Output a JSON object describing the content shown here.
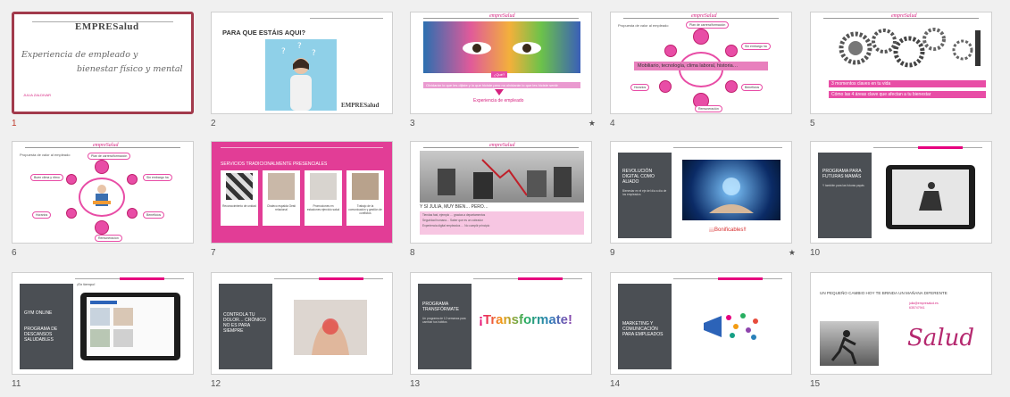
{
  "slides": [
    {
      "num": "1",
      "selected": true,
      "logo": "EMPRESalud",
      "title_line1": "Experiencia de empleado y",
      "title_line2": "bienestar físico y mental",
      "author": "JULIA ZALDIVAR"
    },
    {
      "num": "2",
      "title": "PARA QUE ESTÁIS AQUI?",
      "logo": "EMPRESalud"
    },
    {
      "num": "3",
      "starred": true,
      "logo": "empreSalud",
      "bar_text": "Olvidarán lo que les dijiste y lo que hiciste pero no olvidarán lo que les hiciste sentir",
      "small_tag": "¿Qué?",
      "caption": "Experiencia de empleado"
    },
    {
      "num": "4",
      "logo": "empreSalud",
      "heading": "Propuesta de valor al empleado",
      "bar_text": "Mobiliario, tecnología, clima laboral, historia…",
      "labels": [
        "Plan de carrera/formación",
        "Sin embargo ha",
        "Horarios",
        "Remuneración",
        "Beneficios"
      ]
    },
    {
      "num": "5",
      "logo": "empreSalud",
      "bar1": "3 momentos claves en tu vida",
      "bar2": "Cómo las 4 áreas clave que afectan a tu bienestar"
    },
    {
      "num": "6",
      "logo": "empreSalud",
      "heading": "Propuesta de valor al empleado",
      "labels": [
        "Plan de carrera/formación",
        "Buen clima y ritmo",
        "Sin embargo ha",
        "Horarios",
        "Remuneración",
        "Beneficios"
      ]
    },
    {
      "num": "7",
      "title": "SERVICIOS TRADICIONALMENTE PRESENCIALES",
      "cards": [
        "Reconocimiento de unidad",
        "Chaleco espalda Gesti relacional",
        "Promociones en estaciones ejercicio salud",
        "Trabajo de la comunicación y gestión de conflictos"
      ]
    },
    {
      "num": "8",
      "logo": "empreSalud",
      "heading": "Y SÍ JULIA, MUY BIEN… PERO…",
      "rows": [
        "Tiendas fast, ejemplo … gracias a departamentos",
        "Seguridad humana… Saber que es un cobrador",
        "Experiencia digital empleados … No cumplir principio"
      ]
    },
    {
      "num": "9",
      "starred": true,
      "panel_title": "REVOLUCIÓN DIGITAL COMO ALIADO",
      "panel_body": "Bienestar en el eje del día a día de los empleados",
      "caption": "¡¡¡Bonificables!!"
    },
    {
      "num": "10",
      "panel_title": "PROGRAMA PARA FUTURAS MAMÁS",
      "panel_body": "Y también para las futuras papás"
    },
    {
      "num": "11",
      "panel_title1": "GYM ONLINE",
      "panel_title2": "PROGRAMA DE DESCANSOS SALUDABLES",
      "top_text": "¡En tiempo!"
    },
    {
      "num": "12",
      "panel_title": "CONTROLA TU DOLOR… CRÓNICO NO ES PARA SIEMPRE"
    },
    {
      "num": "13",
      "panel_title": "PROGRAMA TRANSFÓRMATE",
      "panel_body": "Un programa de 12 semanas para cambiar tus hábitos",
      "word": "¡Transformate!"
    },
    {
      "num": "14",
      "panel_title": "MARKETING Y COMUNICACIÓN PARA EMPLEADOS"
    },
    {
      "num": "15",
      "title": "UN PEQUEÑO CAMBIO HOY TE BRINDA UN MAÑANA DIFERENTE",
      "contact": "julia@empresalud.es",
      "phone": "635747941",
      "word": "Salud"
    }
  ]
}
